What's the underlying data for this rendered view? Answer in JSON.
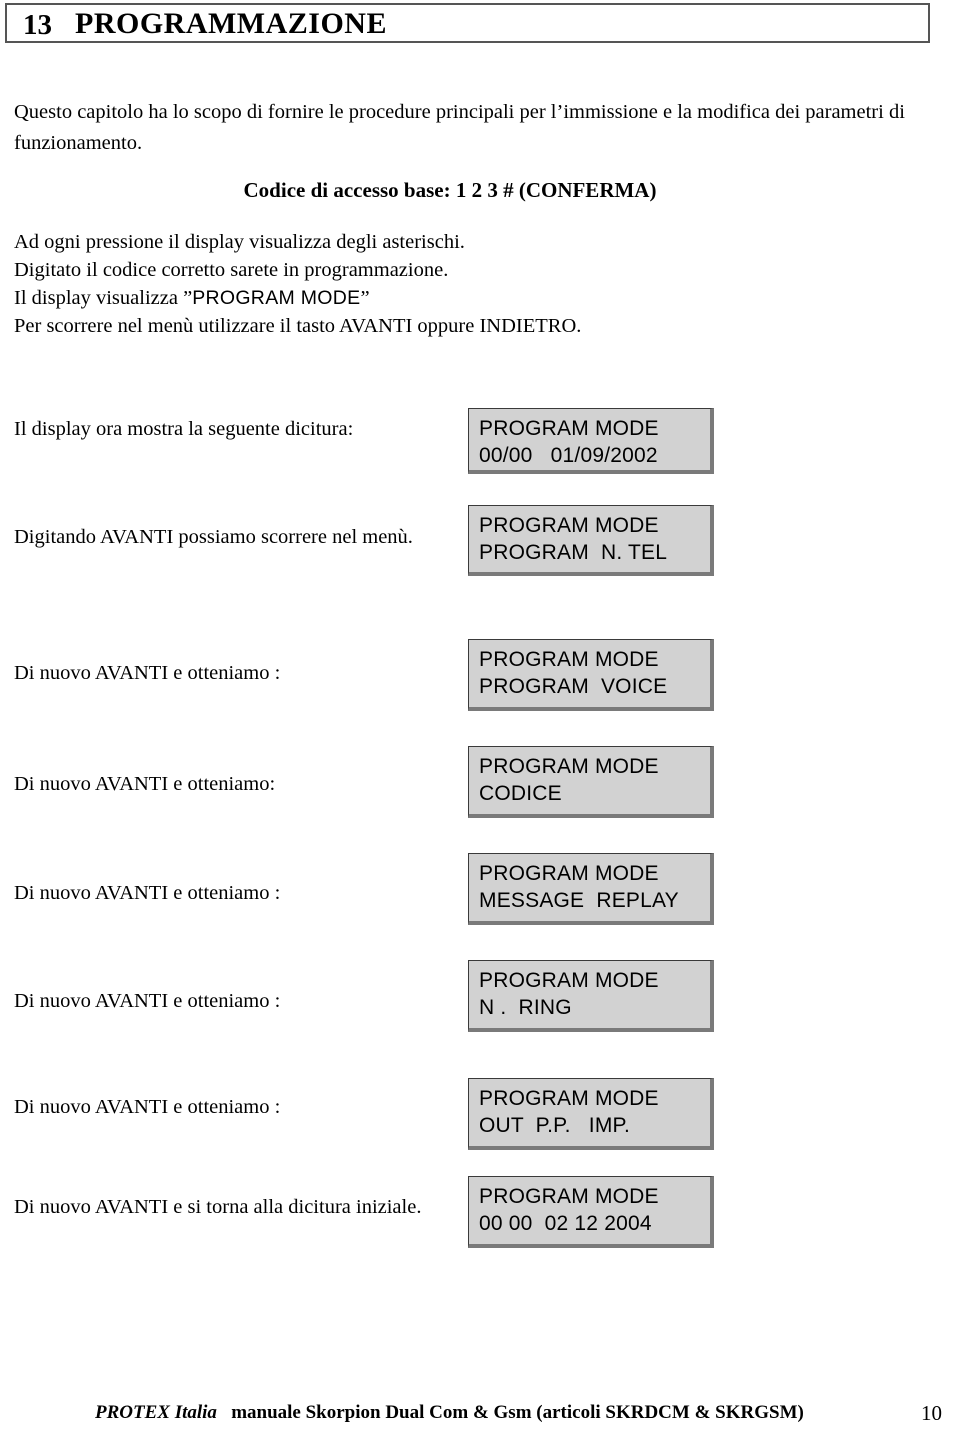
{
  "chapter": {
    "number": "13",
    "title": "PROGRAMMAZIONE"
  },
  "intro": {
    "paragraph": "Questo capitolo ha lo scopo di fornire le procedure principali per l’immissione e la modifica dei parametri di funzionamento."
  },
  "access_code": {
    "line": "Codice di accesso base: 1 2 3  # (CONFERMA)"
  },
  "steps": {
    "line1": "Ad ogni pressione il display visualizza degli asterischi.",
    "line2": "Digitato il codice corretto sarete in programmazione.",
    "line3_prefix": "Il display visualizza ”",
    "line3_lcd": "PROGRAM  MODE",
    "line3_suffix": "”",
    "line4": "Per scorrere nel menù utilizzare il tasto AVANTI oppure INDIETRO."
  },
  "rows": [
    {
      "caption": "Il display ora mostra la seguente dicitura:",
      "lcd_line1": "PROGRAM MODE",
      "lcd_line2": "00/00   01/09/2002"
    },
    {
      "caption": "Digitando AVANTI possiamo scorrere nel menù.",
      "lcd_line1": "PROGRAM MODE",
      "lcd_line2": "PROGRAM  N. TEL"
    },
    {
      "caption": "Di nuovo AVANTI e otteniamo :",
      "lcd_line1": "PROGRAM MODE",
      "lcd_line2": "PROGRAM  VOICE"
    },
    {
      "caption": "Di nuovo AVANTI e otteniamo:",
      "lcd_line1": "PROGRAM MODE",
      "lcd_line2": "CODICE"
    },
    {
      "caption": "Di nuovo AVANTI e otteniamo :",
      "lcd_line1": "PROGRAM MODE",
      "lcd_line2": "MESSAGE  REPLAY"
    },
    {
      "caption": "Di nuovo AVANTI e otteniamo :",
      "lcd_line1": "PROGRAM MODE",
      "lcd_line2": "N .  RING"
    },
    {
      "caption": "Di nuovo AVANTI e otteniamo :",
      "lcd_line1": "PROGRAM MODE",
      "lcd_line2": "OUT  P.P.   IMP."
    },
    {
      "caption": "Di nuovo AVANTI e si torna alla dicitura iniziale.",
      "lcd_line1": "PROGRAM MODE",
      "lcd_line2": "00 00  02 12 2004"
    }
  ],
  "footer": {
    "brand": "PROTEX Italia",
    "text": "manuale Skorpion Dual Com  & Gsm (articoli SKRDCM & SKRGSM)",
    "page": "10"
  },
  "colors": {
    "lcd_background": "#d2d2d2",
    "lcd_border": "#3a3a3a",
    "lcd_shadow": "#7a7a7a",
    "chapter_border": "#555555",
    "text": "#000000"
  }
}
